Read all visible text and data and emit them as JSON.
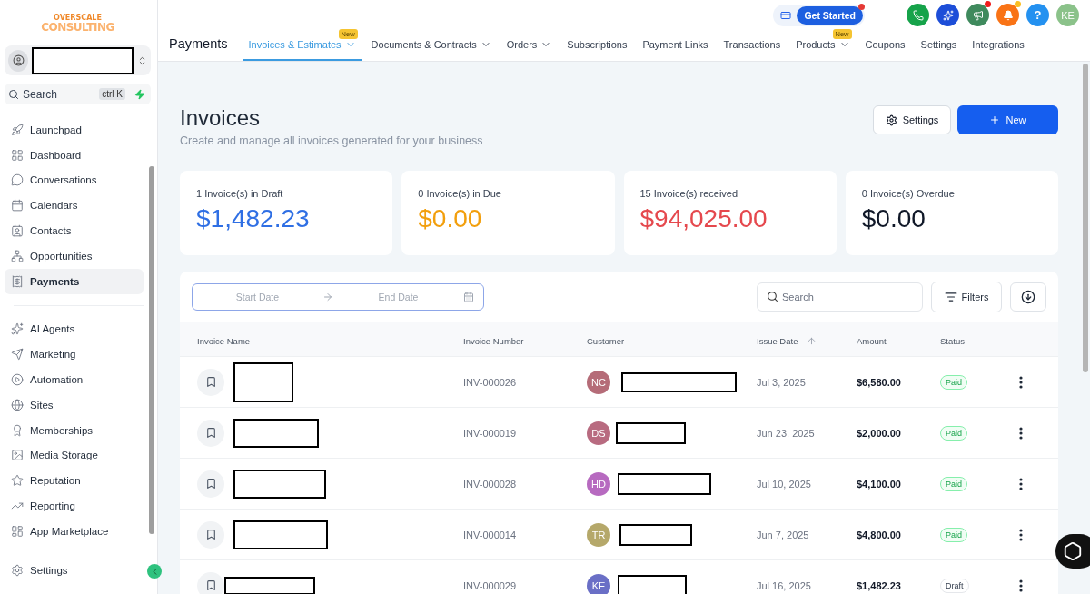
{
  "logo": {
    "line_1": "OVERSCALE",
    "line_2": "CONSULTING"
  },
  "search": {
    "placeholder": "Search",
    "shortcut": "ctrl K"
  },
  "sidebar": {
    "items": [
      {
        "label": "Launchpad",
        "selected": false
      },
      {
        "label": "Dashboard",
        "selected": false
      },
      {
        "label": "Conversations",
        "selected": false
      },
      {
        "label": "Calendars",
        "selected": false
      },
      {
        "label": "Contacts",
        "selected": false
      },
      {
        "label": "Opportunities",
        "selected": false
      },
      {
        "label": "Payments",
        "selected": true
      }
    ],
    "items_2": [
      {
        "label": "AI Agents",
        "selected": false
      },
      {
        "label": "Marketing",
        "selected": false
      },
      {
        "label": "Automation",
        "selected": false
      },
      {
        "label": "Sites",
        "selected": false
      },
      {
        "label": "Memberships",
        "selected": false
      },
      {
        "label": "Media Storage",
        "selected": false
      },
      {
        "label": "Reputation",
        "selected": false
      },
      {
        "label": "Reporting",
        "selected": false
      },
      {
        "label": "App Marketplace",
        "selected": false
      }
    ],
    "settings": "Settings"
  },
  "top_bar": {
    "get_started": "Get Started",
    "help": "?",
    "avatar": "KE"
  },
  "nav": {
    "title": "Payments",
    "tabs": [
      {
        "label": "Invoices & Estimates",
        "selected": true,
        "dropdown": true,
        "badge": "New"
      },
      {
        "label": "Documents & Contracts",
        "selected": false,
        "dropdown": true
      },
      {
        "label": "Orders",
        "selected": false,
        "dropdown": true
      },
      {
        "label": "Subscriptions",
        "selected": false,
        "dropdown": false
      },
      {
        "label": "Payment Links",
        "selected": false,
        "dropdown": false
      },
      {
        "label": "Transactions",
        "selected": false,
        "dropdown": false
      },
      {
        "label": "Products",
        "selected": false,
        "dropdown": true,
        "badge": "New"
      },
      {
        "label": "Coupons",
        "selected": false,
        "dropdown": false
      },
      {
        "label": "Settings",
        "selected": false,
        "dropdown": false
      },
      {
        "label": "Integrations",
        "selected": false,
        "dropdown": false
      }
    ]
  },
  "page": {
    "title": "Invoices",
    "subtitle": "Create and manage all invoices generated for your business",
    "settings_button": "Settings",
    "new_button": "New"
  },
  "stats": [
    {
      "label": "1 Invoice(s) in Draft",
      "value": "$1,482.23",
      "color": "#2f6fe4"
    },
    {
      "label": "0 Invoice(s) in Due",
      "value": "$0.00",
      "color": "#f29f0d"
    },
    {
      "label": "15 Invoice(s) received",
      "value": "$94,025.00",
      "color": "#e5484d"
    },
    {
      "label": "0 Invoice(s) Overdue",
      "value": "$0.00",
      "color": "#101828"
    }
  ],
  "filters": {
    "start_placeholder": "Start Date",
    "end_placeholder": "End Date",
    "search_placeholder": "Search",
    "filters_button": "Filters"
  },
  "table": {
    "columns": [
      {
        "label": "Invoice Name",
        "sorted": false
      },
      {
        "label": "Invoice Number",
        "sorted": false
      },
      {
        "label": "Customer",
        "sorted": false
      },
      {
        "label": "Issue Date",
        "sorted": true
      },
      {
        "label": "Amount",
        "sorted": false
      },
      {
        "label": "Status",
        "sorted": false
      }
    ],
    "rows": [
      {
        "number": "INV-000026",
        "initials": "NC",
        "color": "#b56c78",
        "date": "Jul 3, 2025",
        "amount": "$6,580.00",
        "status": "Paid",
        "kind": "paid"
      },
      {
        "number": "INV-000019",
        "initials": "DS",
        "color": "#b86b80",
        "date": "Jun 23, 2025",
        "amount": "$2,000.00",
        "status": "Paid",
        "kind": "paid"
      },
      {
        "number": "INV-000028",
        "initials": "HD",
        "color": "#b76ac0",
        "date": "Jul 10, 2025",
        "amount": "$4,100.00",
        "status": "Paid",
        "kind": "paid"
      },
      {
        "number": "INV-000014",
        "initials": "TR",
        "color": "#b5a86a",
        "date": "Jun 7, 2025",
        "amount": "$4,800.00",
        "status": "Paid",
        "kind": "paid"
      },
      {
        "number": "INV-000029",
        "initials": "KE",
        "color": "#6a6fc6",
        "date": "Jul 16, 2025",
        "amount": "$1,482.23",
        "status": "Draft",
        "kind": "draft"
      }
    ]
  }
}
